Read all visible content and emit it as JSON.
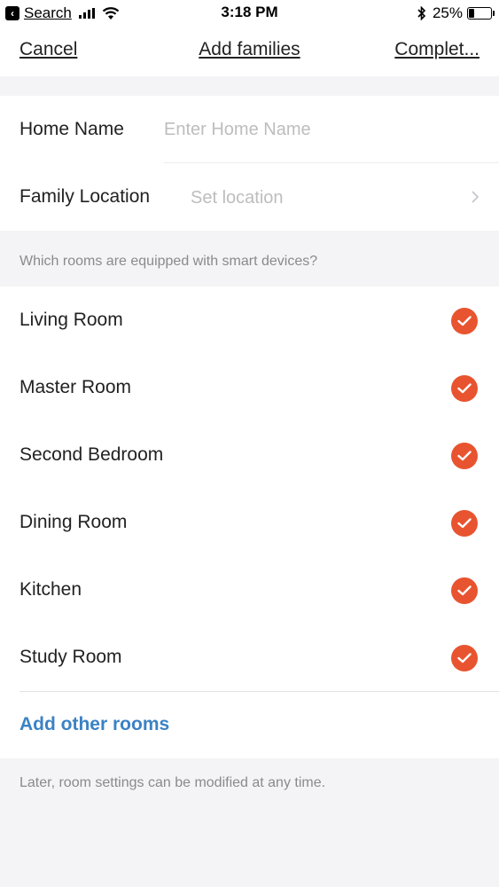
{
  "status_bar": {
    "back_app": "Search",
    "time": "3:18 PM",
    "battery": "25%",
    "battery_level": 0.25
  },
  "nav": {
    "cancel": "Cancel",
    "title": "Add families",
    "complete": "Complet..."
  },
  "form": {
    "home_name_label": "Home Name",
    "home_name_placeholder": "Enter Home Name",
    "home_name_value": "",
    "location_label": "Family Location",
    "location_value": "Set location"
  },
  "rooms_header": "Which rooms are equipped with smart devices?",
  "rooms": [
    {
      "label": "Living Room",
      "checked": true
    },
    {
      "label": "Master Room",
      "checked": true
    },
    {
      "label": "Second Bedroom",
      "checked": true
    },
    {
      "label": "Dining Room",
      "checked": true
    },
    {
      "label": "Kitchen",
      "checked": true
    },
    {
      "label": "Study Room",
      "checked": true
    }
  ],
  "add_rooms": "Add other rooms",
  "footer_note": "Later, room settings can be modified at any time.",
  "colors": {
    "accent": "#e8542f",
    "link": "#3b82c4"
  }
}
